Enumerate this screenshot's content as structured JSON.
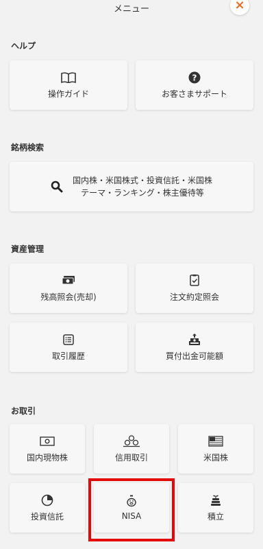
{
  "header": {
    "title": "メニュー",
    "close_symbol": "×"
  },
  "sections": {
    "help": {
      "label": "ヘルプ",
      "items": [
        {
          "label": "操作ガイド",
          "icon": "book-icon"
        },
        {
          "label": "お客さまサポート",
          "icon": "question-circle-icon"
        }
      ]
    },
    "search": {
      "label": "銘柄検索",
      "button": {
        "line1": "国内株・米国株式・投資信託・米国株",
        "line2": "テーマ・ランキング・株主優待等",
        "icon": "search-icon"
      }
    },
    "assets": {
      "label": "資産管理",
      "items": [
        {
          "label": "残高照会(売却)",
          "icon": "money-stack-icon"
        },
        {
          "label": "注文約定照会",
          "icon": "order-document-icon"
        },
        {
          "label": "取引履歴",
          "icon": "list-icon"
        },
        {
          "label": "買付出金可能額",
          "icon": "money-tray-icon"
        }
      ]
    },
    "trade": {
      "label": "お取引",
      "items": [
        {
          "label": "国内現物株",
          "icon": "cash-bill-icon"
        },
        {
          "label": "信用取引",
          "icon": "coins-icon"
        },
        {
          "label": "米国株",
          "icon": "us-flag-icon"
        },
        {
          "label": "投資信託",
          "icon": "pie-chart-icon"
        },
        {
          "label": "NISA",
          "icon": "piggy-bank-icon"
        },
        {
          "label": "積立",
          "icon": "stacked-coins-plant-icon"
        }
      ]
    }
  },
  "colors": {
    "accent_close": "#ee6a1f",
    "highlight_border": "#e30a0a"
  }
}
